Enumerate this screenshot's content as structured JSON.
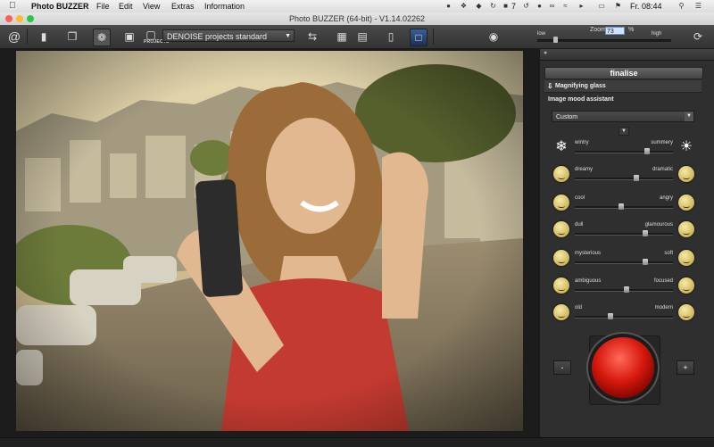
{
  "menubar": {
    "apple": "",
    "app_name": "Photo BUZZER",
    "menus": [
      "File",
      "Edit",
      "View",
      "Extras",
      "Information"
    ],
    "battery_pct": "7",
    "time": "Fr. 08:44"
  },
  "window": {
    "title": "Photo BUZZER (64-bit) - V1.14.02262"
  },
  "toolbar": {
    "projects_label": "PROJECTS",
    "preset_value": "DENOISE projects standard",
    "zoom": {
      "label": "Zoom",
      "value": "73",
      "unit": "%",
      "low": "low",
      "high": "high",
      "slider_fraction": 0.12
    }
  },
  "panel": {
    "finalise": "finalise",
    "magnify": "Magnifying glass",
    "mood_title": "Image mood assistant",
    "mood_preset": "Custom",
    "rows": [
      {
        "left": "wintry",
        "right": "summery",
        "value": 0.74
      },
      {
        "left": "dreamy",
        "right": "dramatic",
        "value": 0.63
      },
      {
        "left": "cool",
        "right": "angry",
        "value": 0.47
      },
      {
        "left": "dull",
        "right": "glamourous",
        "value": 0.72
      },
      {
        "left": "mysterious",
        "right": "soft",
        "value": 0.72
      },
      {
        "left": "ambiguous",
        "right": "focused",
        "value": 0.53
      },
      {
        "left": "old",
        "right": "modern",
        "value": 0.36
      }
    ],
    "minus": "-",
    "plus": "+"
  },
  "colors": {
    "accent_button": "#d6180d",
    "panel_bg": "#2f2f2f"
  }
}
